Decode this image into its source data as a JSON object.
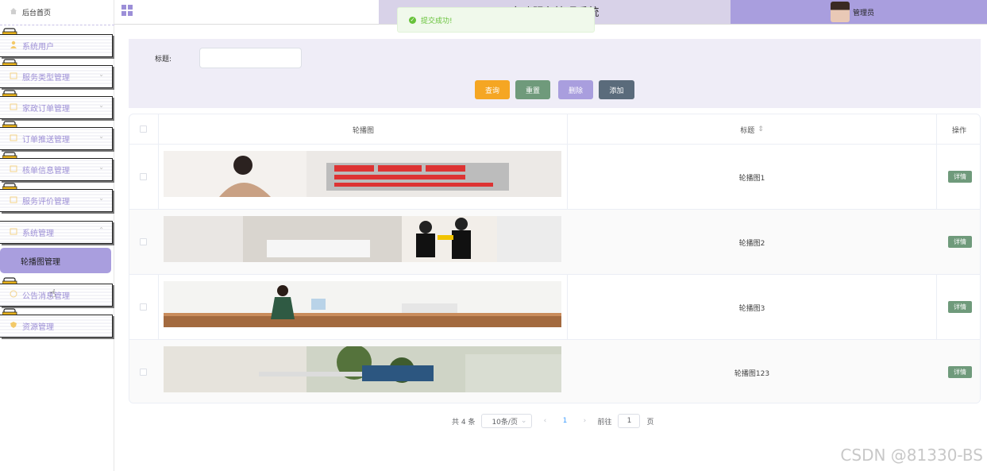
{
  "sidebar": {
    "home_label": "后台首页",
    "menu": [
      {
        "label": "系统用户",
        "icon": "user-icon"
      },
      {
        "label": "服务类型管理",
        "icon": "folder-icon"
      },
      {
        "label": "家政订单管理",
        "icon": "folder-icon"
      },
      {
        "label": "订单推送管理",
        "icon": "folder-icon"
      },
      {
        "label": "核单信息管理",
        "icon": "folder-icon"
      },
      {
        "label": "服务评价管理",
        "icon": "folder-icon"
      },
      {
        "label": "系统管理",
        "icon": "folder-icon"
      },
      {
        "label": "公告消息管理",
        "icon": "info-icon"
      },
      {
        "label": "资源管理",
        "icon": "shield-icon"
      }
    ],
    "active_sub": "轮播图管理"
  },
  "header": {
    "title": "家政服务管理系统",
    "user": "管理员"
  },
  "toast": "提交成功!",
  "search": {
    "label": "标题:",
    "placeholder": "",
    "buttons": {
      "query": "查询",
      "reset": "重置",
      "delete": "删除",
      "add": "添加"
    }
  },
  "table": {
    "headers": {
      "image": "轮播图",
      "title": "标题",
      "actions": "操作"
    },
    "rows": [
      {
        "title": "轮播图1",
        "action": "详情"
      },
      {
        "title": "轮播图2",
        "action": "详情"
      },
      {
        "title": "轮播图3",
        "action": "详情"
      },
      {
        "title": "轮播图123",
        "action": "详情"
      }
    ]
  },
  "pagination": {
    "total": "共 4 条",
    "page_size": "10条/页",
    "current": "1",
    "goto_label": "前往",
    "goto_value": "1",
    "page_suffix": "页"
  },
  "watermark": "CSDN @81330-BS",
  "colors": {
    "accent": "#a99ede",
    "query": "#f5a623",
    "reset": "#6f9a7b",
    "delete": "#a99ede",
    "add": "#5a6b7b"
  }
}
